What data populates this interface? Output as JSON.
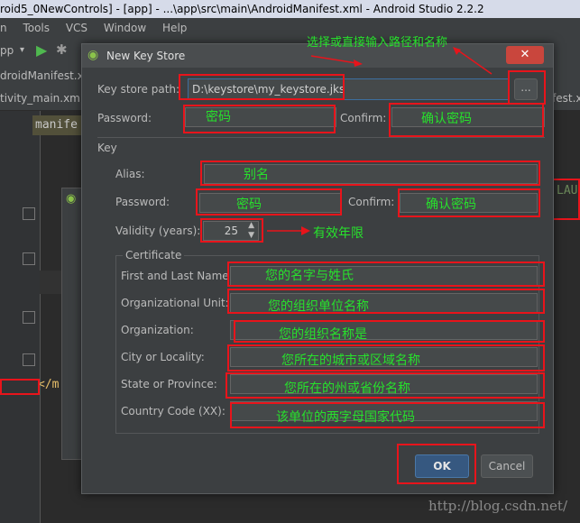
{
  "ide": {
    "window_title": "roid5_0NewControls] - [app] - ...\\app\\src\\main\\AndroidManifest.xml - Android Studio 2.2.2",
    "menu": [
      "n",
      "Tools",
      "VCS",
      "Window",
      "Help"
    ],
    "module_selector": "pp",
    "tab_manifest": "droidManifest.x",
    "tab_activity": "tivity_main.xml",
    "tab_right": "fest.x",
    "editor_crumb": "manife",
    "code_right": "LAU",
    "code_closing": "</m"
  },
  "dialog": {
    "title": "New Key Store",
    "key_store_path_label": "Key store path:",
    "key_store_path_value": "D:\\keystore\\my_keystore.jks",
    "browse_button": "...",
    "password_label": "Password:",
    "confirm_label": "Confirm:",
    "key_section": "Key",
    "alias_label": "Alias:",
    "key_password_label": "Password:",
    "key_confirm_label": "Confirm:",
    "validity_label": "Validity (years):",
    "validity_value": "25",
    "certificate_section": "Certificate",
    "first_last_label": "First and Last Name:",
    "org_unit_label": "Organizational Unit:",
    "organization_label": "Organization:",
    "city_label": "City or Locality:",
    "state_label": "State or Province:",
    "country_label": "Country Code (XX):",
    "ok_button": "OK",
    "cancel_button": "Cancel"
  },
  "annotations": {
    "header": "选择或直接输入路径和名称",
    "password": "密码",
    "confirm": "确认密码",
    "alias": "别名",
    "key_password": "密码",
    "key_confirm": "确认密码",
    "validity": "有效年限",
    "first_last": "您的名字与姓氏",
    "org_unit": "您的组织单位名称",
    "organization": "您的组织名称是",
    "city": "您所在的城市或区域名称",
    "state": "您所在的州或省份名称",
    "country": "该单位的两字母国家代码"
  },
  "watermark": "http://blog.csdn.net/",
  "colors": {
    "annotation_box": "#e8141b",
    "annotation_text": "#27e12c",
    "dialog_bg": "#3c3f41"
  }
}
